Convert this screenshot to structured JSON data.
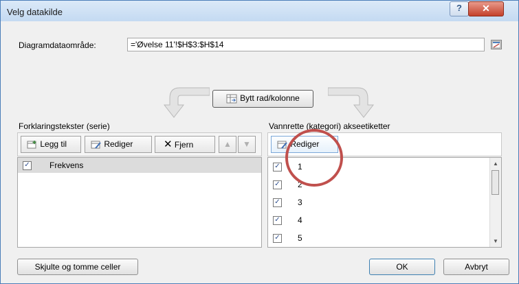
{
  "window": {
    "title": "Velg datakilde"
  },
  "range": {
    "label": "Diagramdataområde:",
    "value": "='Øvelse 11'!$H$3:$H$14"
  },
  "switch_button": "Bytt rad/kolonne",
  "legend": {
    "title": "Forklaringstekster (serie)",
    "add": "Legg til",
    "edit": "Rediger",
    "remove": "Fjern",
    "series": [
      {
        "name": "Frekvens",
        "checked": true
      }
    ]
  },
  "axis": {
    "title": "Vannrette (kategori) akseetiketter",
    "edit": "Rediger",
    "labels": [
      "1",
      "2",
      "3",
      "4",
      "5"
    ]
  },
  "footer": {
    "hidden_cells": "Skjulte og tomme celler",
    "ok": "OK",
    "cancel": "Avbryt"
  },
  "annotation": {
    "color": "#c0504d"
  }
}
